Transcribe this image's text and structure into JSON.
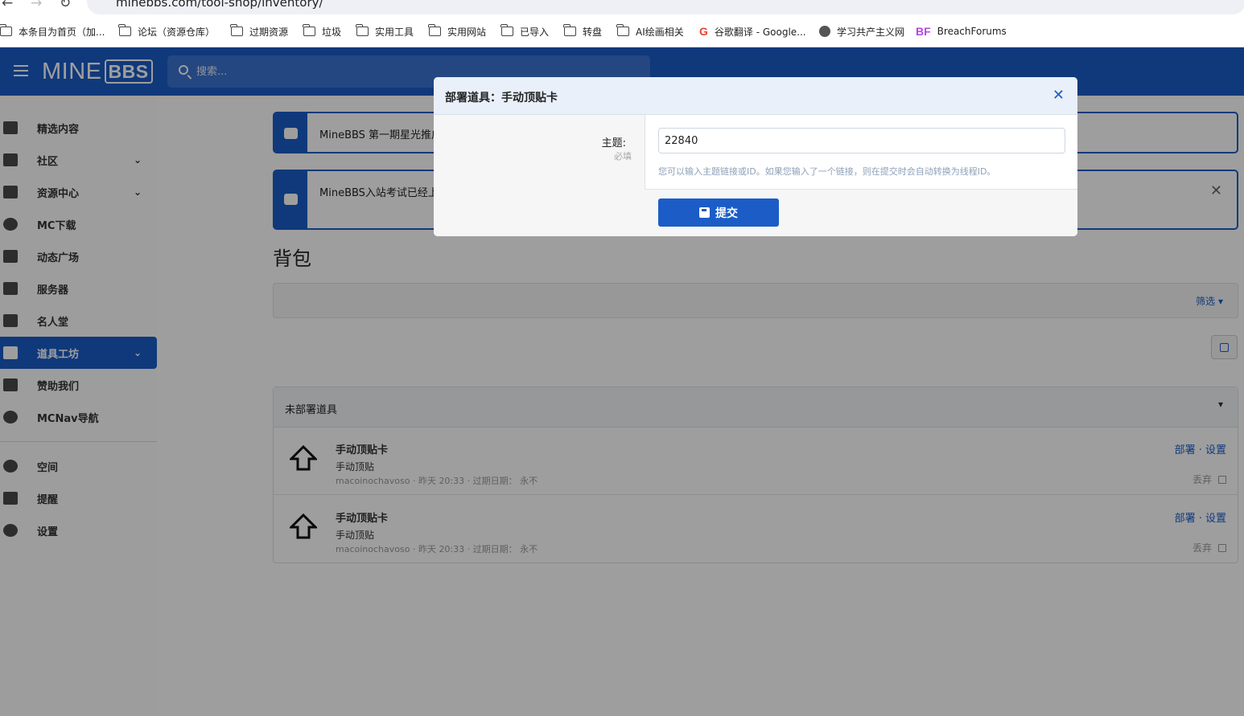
{
  "browser": {
    "url": "minebbs.com/tool-shop/inventory/",
    "bookmarks": [
      {
        "label": "本条目为首页（加...",
        "icon": "folder-icon"
      },
      {
        "label": "论坛（资源仓库）",
        "icon": "folder-icon"
      },
      {
        "label": "过期资源",
        "icon": "folder-icon"
      },
      {
        "label": "垃圾",
        "icon": "folder-icon"
      },
      {
        "label": "实用工具",
        "icon": "folder-icon"
      },
      {
        "label": "实用网站",
        "icon": "folder-icon"
      },
      {
        "label": "已导入",
        "icon": "folder-icon"
      },
      {
        "label": "转盘",
        "icon": "folder-icon"
      },
      {
        "label": "AI绘画相关",
        "icon": "folder-icon"
      },
      {
        "label": "谷歌翻译 - Google...",
        "icon": "google-icon"
      },
      {
        "label": "学习共产主义网",
        "icon": "globe-icon"
      },
      {
        "label": "BreachForums",
        "icon": "bf-icon"
      }
    ]
  },
  "header": {
    "logo_main": "MINE",
    "logo_accent": "BBS",
    "search_placeholder": "搜索..."
  },
  "sidebar": {
    "items": [
      {
        "label": "精选内容",
        "icon": "folder-icon",
        "chevron": false,
        "active": false
      },
      {
        "label": "社区",
        "icon": "comments-icon",
        "chevron": true,
        "active": false
      },
      {
        "label": "资源中心",
        "icon": "box-icon",
        "chevron": true,
        "active": false
      },
      {
        "label": "MC下载",
        "icon": "cloud-download-icon",
        "chevron": false,
        "active": false
      },
      {
        "label": "动态广场",
        "icon": "megaphone-icon",
        "chevron": false,
        "active": false
      },
      {
        "label": "服务器",
        "icon": "server-icon",
        "chevron": false,
        "active": false
      },
      {
        "label": "名人堂",
        "icon": "person-icon",
        "chevron": false,
        "active": false
      },
      {
        "label": "道具工坊",
        "icon": "tools-icon",
        "chevron": true,
        "active": true
      },
      {
        "label": "赞助我们",
        "icon": "battery-icon",
        "chevron": false,
        "active": false
      },
      {
        "label": "MCNav导航",
        "icon": "compass-icon",
        "chevron": false,
        "active": false
      }
    ],
    "user_items": [
      {
        "label": "空间",
        "icon": "user-icon"
      },
      {
        "label": "提醒",
        "icon": "bell-icon"
      },
      {
        "label": "设置",
        "icon": "gear-icon"
      }
    ]
  },
  "notices": [
    {
      "text": "MineBBS 第一期星光推广"
    },
    {
      "text": "MineBBS入站考试已经上"
    }
  ],
  "page": {
    "title": "背包",
    "filter_label": "筛选"
  },
  "block": {
    "title": "未部署道具",
    "items": [
      {
        "title": "手动顶贴卡",
        "desc": "手动顶贴",
        "meta": "macoinochavoso · 昨天 20:33 · 过期日期： 永不",
        "actions": "部署 · 设置",
        "discard": "丢弃"
      },
      {
        "title": "手动顶贴卡",
        "desc": "手动顶贴",
        "meta": "macoinochavoso · 昨天 20:33 · 过期日期： 永不",
        "actions": "部署 · 设置",
        "discard": "丢弃"
      }
    ]
  },
  "modal": {
    "title": "部署道具：手动顶贴卡",
    "field_label": "主题:",
    "field_required": "必填",
    "field_value": "22840",
    "field_explain": "您可以输入主题链接或ID。如果您输入了一个链接，则在提交时会自动转换为线程ID。",
    "submit_label": "提交"
  },
  "colors": {
    "brand": "#1b5cc7"
  }
}
